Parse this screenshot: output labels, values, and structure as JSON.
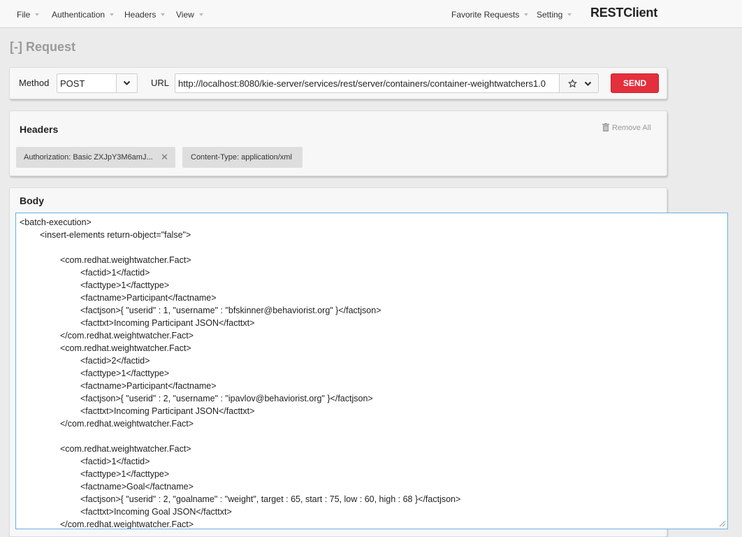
{
  "menu": {
    "left": [
      "File",
      "Authentication",
      "Headers",
      "View"
    ],
    "right": [
      "Favorite Requests",
      "Setting"
    ],
    "brand": "RESTClient"
  },
  "request": {
    "section_title": "[-] Request",
    "method_label": "Method",
    "method_value": "POST",
    "url_label": "URL",
    "url_value": "http://localhost:8080/kie-server/services/rest/server/containers/container-weightwatchers1.0",
    "send_label": "SEND"
  },
  "headers": {
    "title": "Headers",
    "remove_all_label": "Remove All",
    "items": [
      "Authorization: Basic ZXJpY3M6amJ...",
      "Content-Type: application/xml"
    ]
  },
  "body": {
    "title": "Body",
    "lines": [
      "<batch-execution>",
      "\t<insert-elements return-object=\"false\">",
      "",
      "\t\t<com.redhat.weightwatcher.Fact>",
      "\t\t\t<factid>1</factid>",
      "\t\t\t<facttype>1</facttype>",
      "\t\t\t<factname>Participant</factname>",
      "\t\t\t<factjson>{ \"userid\" : 1, \"username\" : \"bfskinner@behaviorist.org\" }</factjson>",
      "\t\t\t<facttxt>Incoming Participant JSON</facttxt>",
      "\t\t</com.redhat.weightwatcher.Fact>",
      "\t\t<com.redhat.weightwatcher.Fact>",
      "\t\t\t<factid>2</factid>",
      "\t\t\t<facttype>1</facttype>",
      "\t\t\t<factname>Participant</factname>",
      "\t\t\t<factjson>{ \"userid\" : 2, \"username\" : \"ipavlov@behaviorist.org\" }</factjson>",
      "\t\t\t<facttxt>Incoming Participant JSON</facttxt>",
      "\t\t</com.redhat.weightwatcher.Fact>",
      "",
      "\t\t<com.redhat.weightwatcher.Fact>",
      "\t\t\t<factid>1</factid>",
      "\t\t\t<facttype>1</facttype>",
      "\t\t\t<factname>Goal</factname>",
      "\t\t\t<factjson>{ \"userid\" : 2, \"goalname\" : \"weight\", target : 65, start : 75, low : 60, high : 68 }</factjson>",
      "\t\t\t<facttxt>Incoming Goal JSON</facttxt>",
      "\t\t</com.redhat.weightwatcher.Fact>"
    ]
  },
  "icons": {
    "favorite": "star-icon",
    "dropdown": "chevron-down-icon",
    "remove": "trash-icon",
    "close": "close-icon"
  },
  "colors": {
    "send": "#e42f3c",
    "focus_border": "#66afe9",
    "page_bg": "#ebebeb"
  }
}
